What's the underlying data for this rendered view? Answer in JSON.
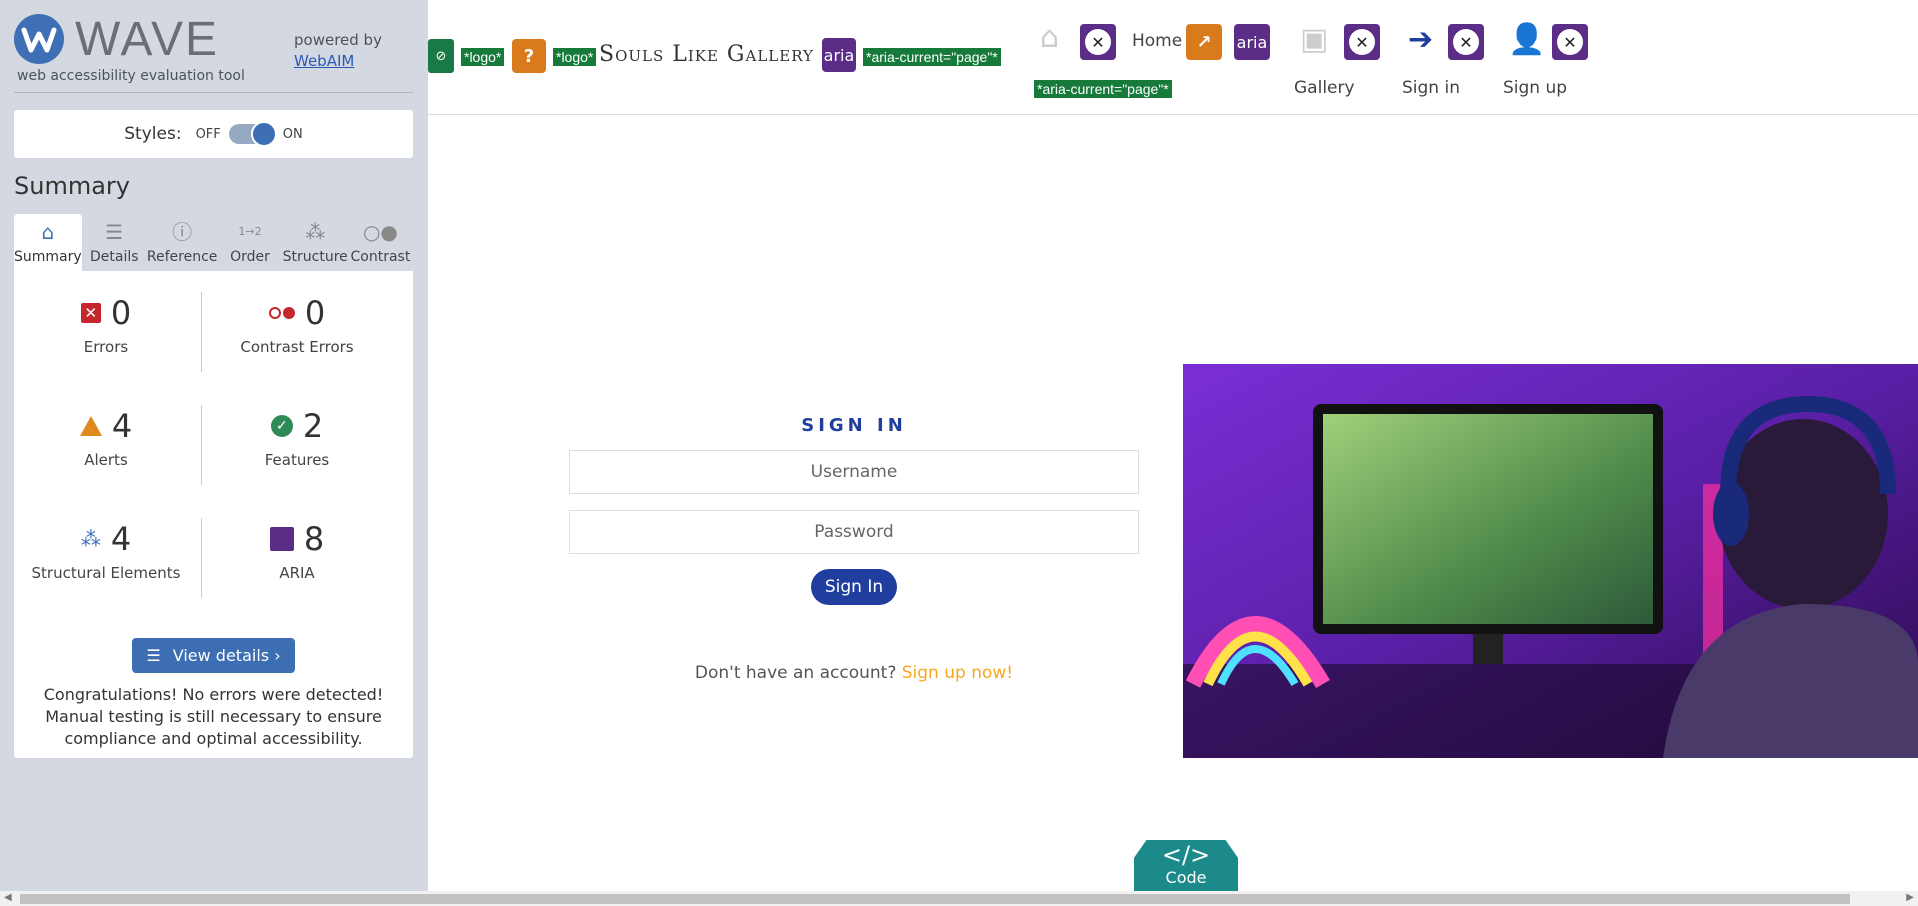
{
  "wave": {
    "brand": "WAVE",
    "tagline": "web accessibility evaluation tool",
    "powered_by": "powered by",
    "webaim": "WebAIM",
    "styles_label": "Styles:",
    "styles_off": "OFF",
    "styles_on": "ON",
    "summary_heading": "Summary",
    "tabs": [
      {
        "label": "Summary",
        "icon": "home-icon"
      },
      {
        "label": "Details",
        "icon": "list-icon"
      },
      {
        "label": "Reference",
        "icon": "info-icon"
      },
      {
        "label": "Order",
        "icon": "order-icon"
      },
      {
        "label": "Structure",
        "icon": "structure-icon"
      },
      {
        "label": "Contrast",
        "icon": "contrast-icon"
      }
    ],
    "stats": {
      "errors": {
        "count": "0",
        "label": "Errors"
      },
      "contrast": {
        "count": "0",
        "label": "Contrast Errors"
      },
      "alerts": {
        "count": "4",
        "label": "Alerts"
      },
      "features": {
        "count": "2",
        "label": "Features"
      },
      "structural": {
        "count": "4",
        "label": "Structural Elements"
      },
      "aria": {
        "count": "8",
        "label": "ARIA"
      }
    },
    "view_details": "View details ›",
    "congrats": "Congratulations! No errors were detected! Manual testing is still necessary to ensure compliance and optimal accessibility."
  },
  "site": {
    "brand": "Souls Like Gallery",
    "tag_logo": "*logo*",
    "tag_aria": "aria",
    "tag_aria_current": "*aria-current=\"page\"*",
    "nav": {
      "home": "Home",
      "gallery": "Gallery",
      "signin": "Sign in",
      "signup": "Sign up"
    },
    "form": {
      "heading": "SIGN IN",
      "username_placeholder": "Username",
      "password_placeholder": "Password",
      "submit": "Sign In",
      "no_account": "Don't have an account?",
      "signup_link": "Sign up now!"
    },
    "code_button": "Code",
    "code_symbol": "</>"
  },
  "colors": {
    "wave_sidebar": "#d4d9e1",
    "wave_accent": "#3d6db3",
    "site_primary": "#1f3e9e",
    "link_orange": "#f5a623",
    "wave_green": "#157a3a",
    "wave_purple": "#5b2d86",
    "wave_teal": "#1c8a8a"
  }
}
